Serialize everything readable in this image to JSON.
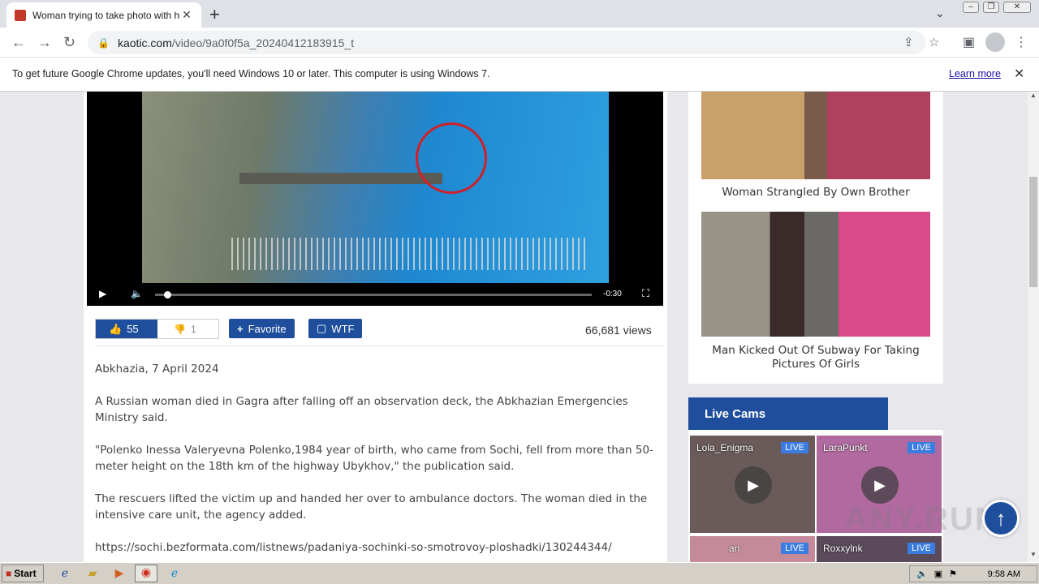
{
  "browser": {
    "tab_title": "Woman trying to take photo with he",
    "new_tab": "+",
    "url_host": "kaotic.com",
    "url_path": "/video/9a0f0f5a_20240412183915_t",
    "infobar_message": "To get future Google Chrome updates, you'll need Windows 10 or later. This computer is using Windows 7.",
    "infobar_link": "Learn more"
  },
  "video": {
    "time": "-0:30",
    "progress": 0.02
  },
  "actions": {
    "likes": "55",
    "dislikes": "1",
    "favorite_label": "Favorite",
    "wtf_label": "WTF",
    "views": "66,681 views"
  },
  "article": {
    "paragraphs": [
      "Abkhazia, 7 April 2024",
      "A Russian woman died in Gagra after falling off an observation deck, the Abkhazian Emergencies Ministry said.",
      "\"Polenko Inessa Valeryevna Polenko,1984 year of birth, who came from Sochi, fell from more than 50-meter height on the 18th km of the highway Ubykhov,\" the publication said.",
      "The rescuers lifted the victim up and handed her over to ambulance doctors. The woman died in the intensive care unit, the agency added.",
      "https://sochi.bezformata.com/listnews/padaniya-sochinki-so-smotrovoy-ploshadki/130244344/"
    ]
  },
  "sidebar": {
    "related": [
      {
        "caption": "Woman Strangled By Own Brother"
      },
      {
        "caption": "Man Kicked Out Of Subway For Taking Pictures Of Girls"
      }
    ],
    "live_cams_title": "Live Cams",
    "cams": [
      {
        "name": "Lola_Enigma",
        "badge": "LIVE",
        "color": "#6a5a5a"
      },
      {
        "name": "LaraPunkt",
        "badge": "LIVE",
        "color": "#b06aa0"
      },
      {
        "name": "an",
        "badge": "LIVE",
        "color": "#c48a9a"
      },
      {
        "name": "Roxxylnk",
        "badge": "LIVE",
        "color": "#5a4a5a"
      }
    ]
  },
  "taskbar": {
    "start_label": "Start",
    "clock": "9:58 AM"
  },
  "watermark": "ANY.RUN"
}
